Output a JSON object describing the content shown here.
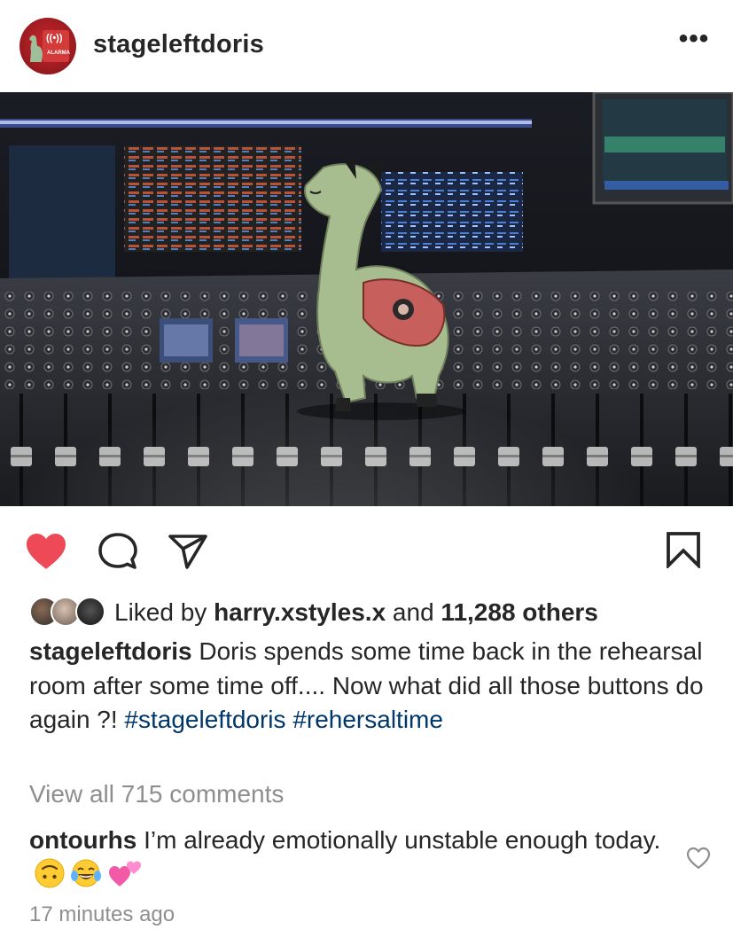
{
  "post": {
    "username": "stageleftdoris",
    "avatar_badge": "ALARMA",
    "more_label": "•••",
    "image_alt": "Green plush llama toy standing on a mixing console"
  },
  "actions": {
    "like_icon": "heart-filled-icon",
    "comment_icon": "comment-icon",
    "share_icon": "send-icon",
    "save_icon": "bookmark-icon",
    "liked_color": "#ed4956"
  },
  "likes": {
    "prefix": "Liked by ",
    "user": "harry.xstyles.x",
    "middle": " and ",
    "others": "11,288 others"
  },
  "caption": {
    "username": "stageleftdoris",
    "text": " Doris spends some time back in the rehearsal room after some time off.... Now what did all those buttons do again ?! ",
    "hashtag1": "#stageleftdoris",
    "hashtag2": "#rehersaltime"
  },
  "comments": {
    "view_all": "View all 715 comments",
    "items": [
      {
        "username": "ontourhs",
        "text": " I’m already emotionally unstable enough today.",
        "emojis": [
          "upside-down-face",
          "tears-of-joy",
          "two-hearts"
        ]
      }
    ]
  },
  "timestamp": "17 minutes ago",
  "colors": {
    "text": "#262626",
    "muted": "#8e8e8e",
    "hashtag": "#00376b",
    "like_red": "#ed4956"
  }
}
